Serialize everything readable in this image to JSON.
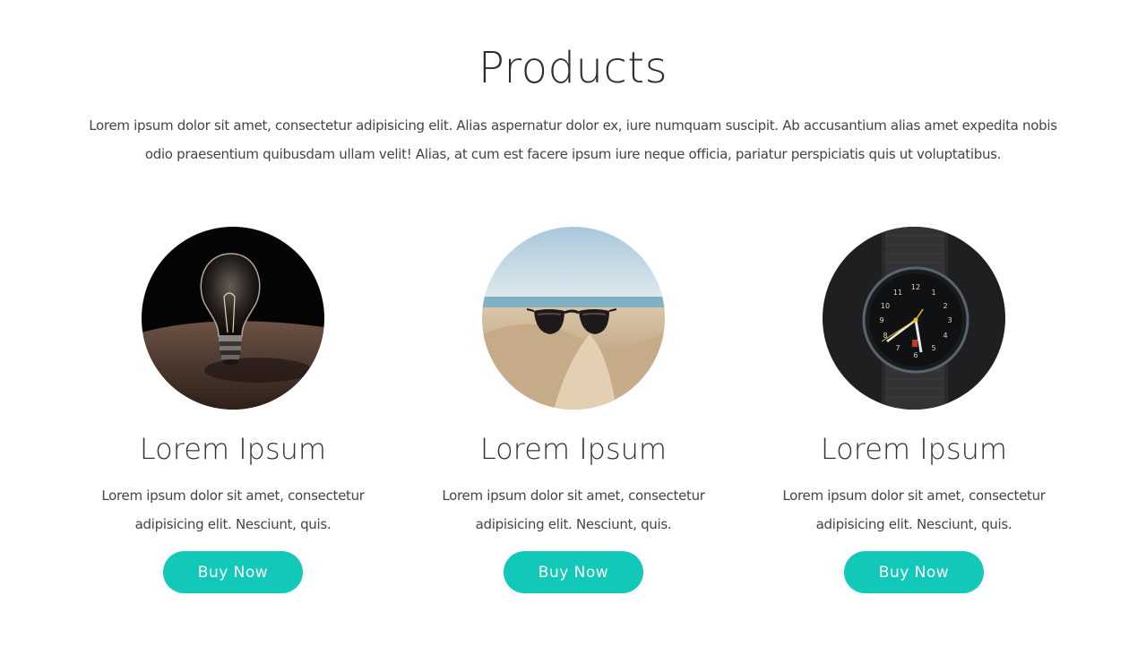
{
  "section": {
    "title": "Products",
    "intro": "Lorem ipsum dolor sit amet, consectetur adipisicing elit. Alias aspernatur dolor ex, iure numquam suscipit. Ab accusantium alias amet expedita nobis odio praesentium quibusdam ullam velit! Alias, at cum est facere ipsum iure neque officia, pariatur perspiciatis quis ut voluptatibus."
  },
  "products": [
    {
      "image": "lightbulb-photo",
      "title": "Lorem Ipsum",
      "description": "Lorem ipsum dolor sit amet, consectetur adipisicing elit. Nesciunt, quis.",
      "button_label": "Buy Now"
    },
    {
      "image": "sunglasses-on-beach-photo",
      "title": "Lorem Ipsum",
      "description": "Lorem ipsum dolor sit amet, consectetur adipisicing elit. Nesciunt, quis.",
      "button_label": "Buy Now"
    },
    {
      "image": "wristwatch-photo",
      "title": "Lorem Ipsum",
      "description": "Lorem ipsum dolor sit amet, consectetur adipisicing elit. Nesciunt, quis.",
      "button_label": "Buy Now"
    }
  ],
  "colors": {
    "accent": "#12c8b8",
    "heading": "#2e2e2e",
    "text": "#444444",
    "background": "#ffffff"
  }
}
